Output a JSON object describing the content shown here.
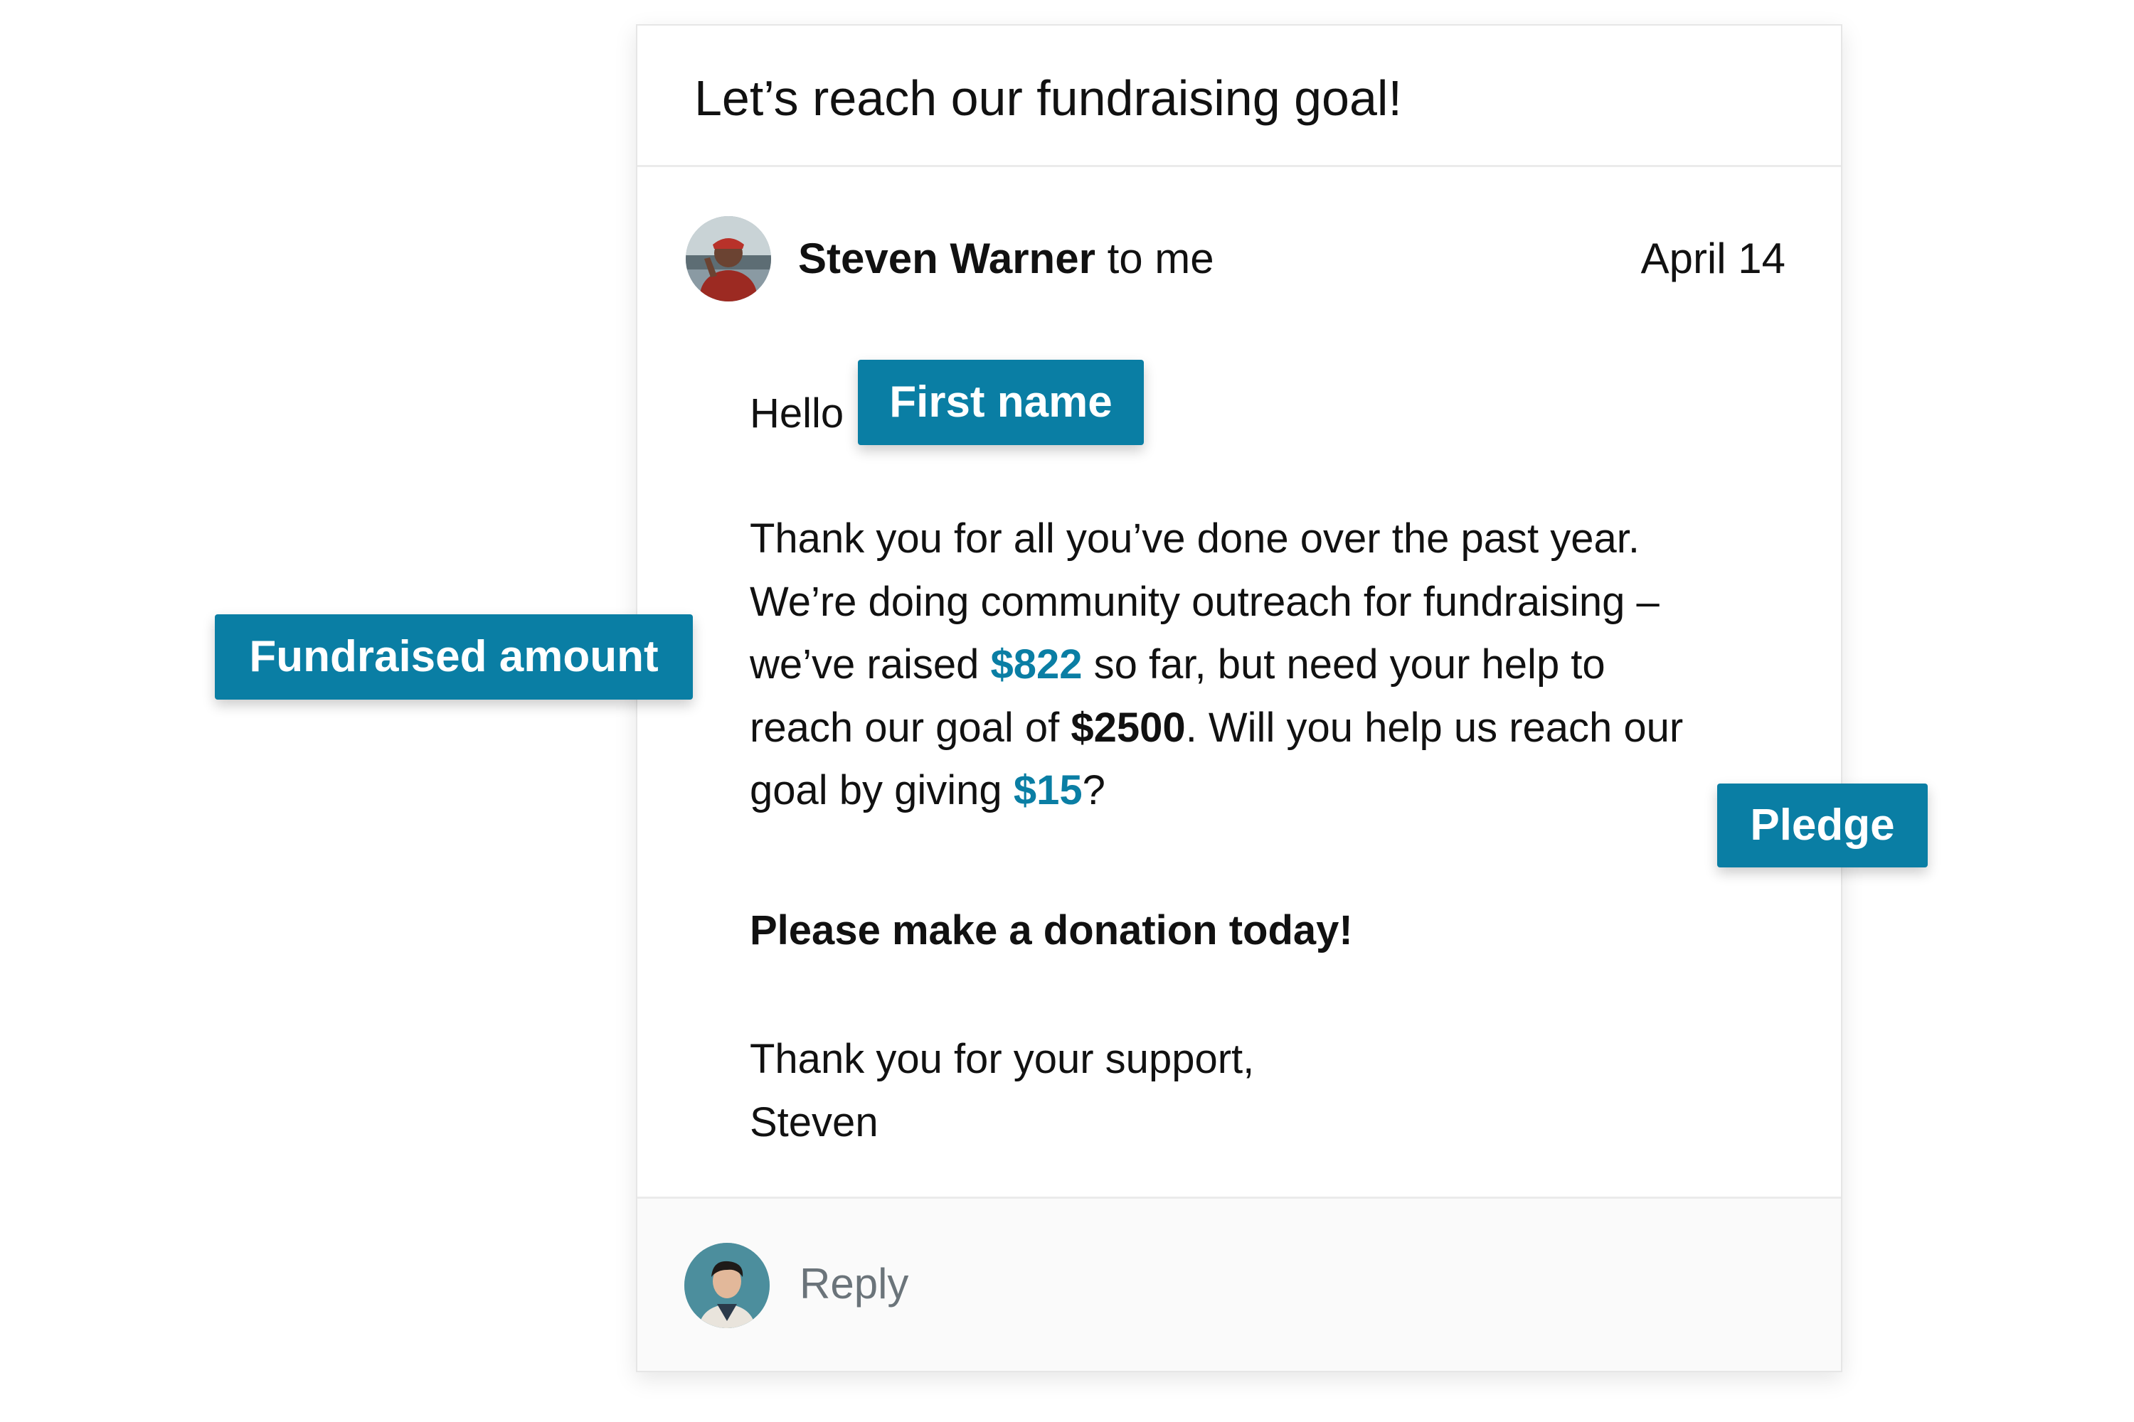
{
  "email": {
    "subject": "Let’s reach our fundraising goal!",
    "sender_name": "Steven Warner",
    "recipient_text": " to me",
    "date": "April 14",
    "greeting": "Hello",
    "body_lines": [
      "Thank you for all you’ve done over the past year.",
      "We’re doing community outreach for fundraising –"
    ],
    "line3_prefix": "we’ve raised ",
    "raised_amount": "$822",
    "line3_suffix": " so far, but need your help to",
    "line4_prefix": "reach our goal of ",
    "goal_amount": "$2500",
    "line4_suffix": ". Will you help us reach our",
    "line5_prefix": "goal by giving ",
    "pledge_amount": "$15",
    "line5_suffix": "?",
    "call_to_action": "Please make a donation today!",
    "closing_line": "Thank you for your support,",
    "signature": "Steven",
    "reply_placeholder": "Reply"
  },
  "tags": {
    "first_name": "First name",
    "fundraised_amount": "Fundraised amount",
    "pledge": "Pledge"
  },
  "colors": {
    "accent": "#0a7ea4",
    "text": "#111111",
    "muted": "#6b747a"
  }
}
